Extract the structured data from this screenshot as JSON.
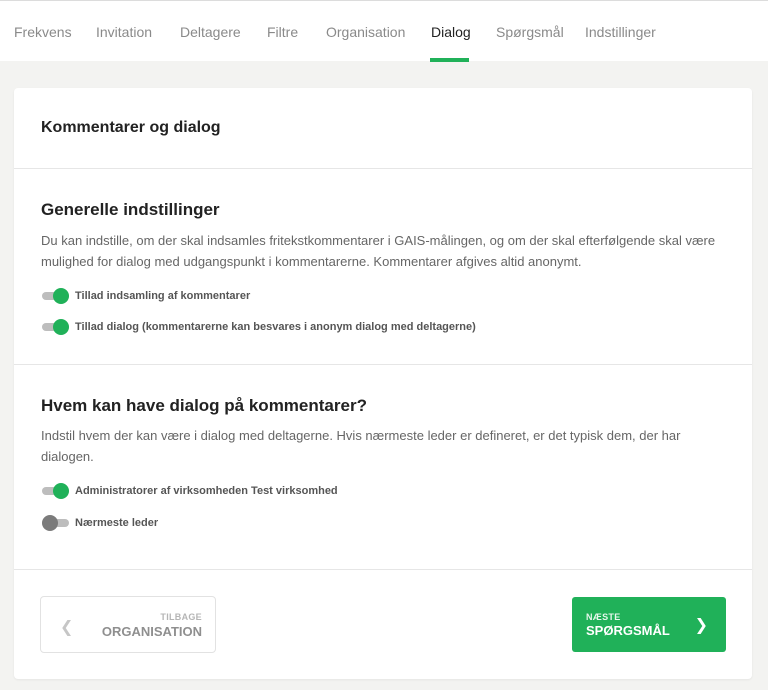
{
  "tabs": [
    {
      "label": "Frekvens"
    },
    {
      "label": "Invitation"
    },
    {
      "label": "Deltagere"
    },
    {
      "label": "Filtre"
    },
    {
      "label": "Organisation"
    },
    {
      "label": "Dialog",
      "active": true
    },
    {
      "label": "Spørgsmål"
    },
    {
      "label": "Indstillinger"
    }
  ],
  "card": {
    "title": "Kommentarer og dialog",
    "general": {
      "title": "Generelle indstillinger",
      "description": "Du kan indstille, om der skal indsamles fritekstkommentarer i GAIS-målingen, og om der skal efterfølgende skal være mulighed for dialog med udgangspunkt i kommentarerne. Kommentarer afgives altid anonymt.",
      "toggles": [
        {
          "label": "Tillad indsamling af kommentarer",
          "on": true
        },
        {
          "label": "Tillad dialog (kommentarerne kan besvares i anonym dialog med deltagerne)",
          "on": true
        }
      ]
    },
    "dialog": {
      "title": "Hvem kan have dialog på kommentarer?",
      "description": "Indstil hvem der kan være i dialog med deltagerne. Hvis nærmeste leder er defineret, er det typisk dem, der har dialogen.",
      "toggles": [
        {
          "label": "Administratorer af virksomheden Test virksomhed",
          "on": true
        },
        {
          "label": "Nærmeste leder",
          "on": false
        }
      ]
    }
  },
  "footer": {
    "back": {
      "small": "TILBAGE",
      "label": "ORGANISATION",
      "icon": "chevron-left-icon"
    },
    "next": {
      "small": "NÆSTE",
      "label": "SPØRGSMÅL",
      "icon": "chevron-right-icon"
    }
  },
  "colors": {
    "accent": "#20b159",
    "toggle_off": "#7b7b7b"
  }
}
